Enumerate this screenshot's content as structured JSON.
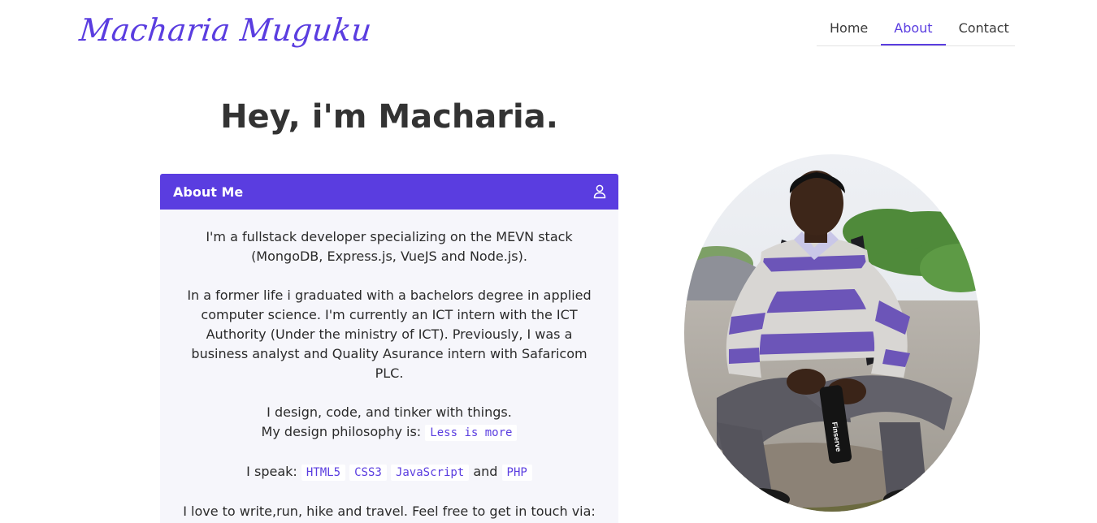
{
  "header": {
    "logo": "Macharia Muguku",
    "nav": [
      {
        "label": "Home",
        "active": false
      },
      {
        "label": "About",
        "active": true
      },
      {
        "label": "Contact",
        "active": false
      }
    ]
  },
  "hero": {
    "title": "Hey, i'm Macharia."
  },
  "about_card": {
    "title": "About Me",
    "icon": "user-icon",
    "p1": "I'm a fullstack developer specializing on the MEVN stack (MongoDB, Express.js, VueJS and Node.js).",
    "p2": "In a former life i graduated with a bachelors degree in applied computer science. I'm currently an ICT intern with the ICT Authority (Under the ministry of ICT). Previously, I was a business analyst and Quality Asurance intern with Safaricom PLC.",
    "p3_line1": "I design, code, and tinker with things.",
    "p3_line2_prefix": "My design philosophy is:",
    "philosophy": "Less is more",
    "speak_prefix": "I speak:",
    "languages": [
      "HTML5",
      "CSS3",
      "JavaScript",
      "PHP"
    ],
    "speak_and": "and",
    "p5": "I love to write,run, hike and travel. Feel free to get in touch via:"
  },
  "photo": {
    "bottle_text": "Finserve"
  },
  "colors": {
    "accent": "#5a3de0",
    "card_bg": "#f6f6fb",
    "text": "#2b2b2b"
  }
}
